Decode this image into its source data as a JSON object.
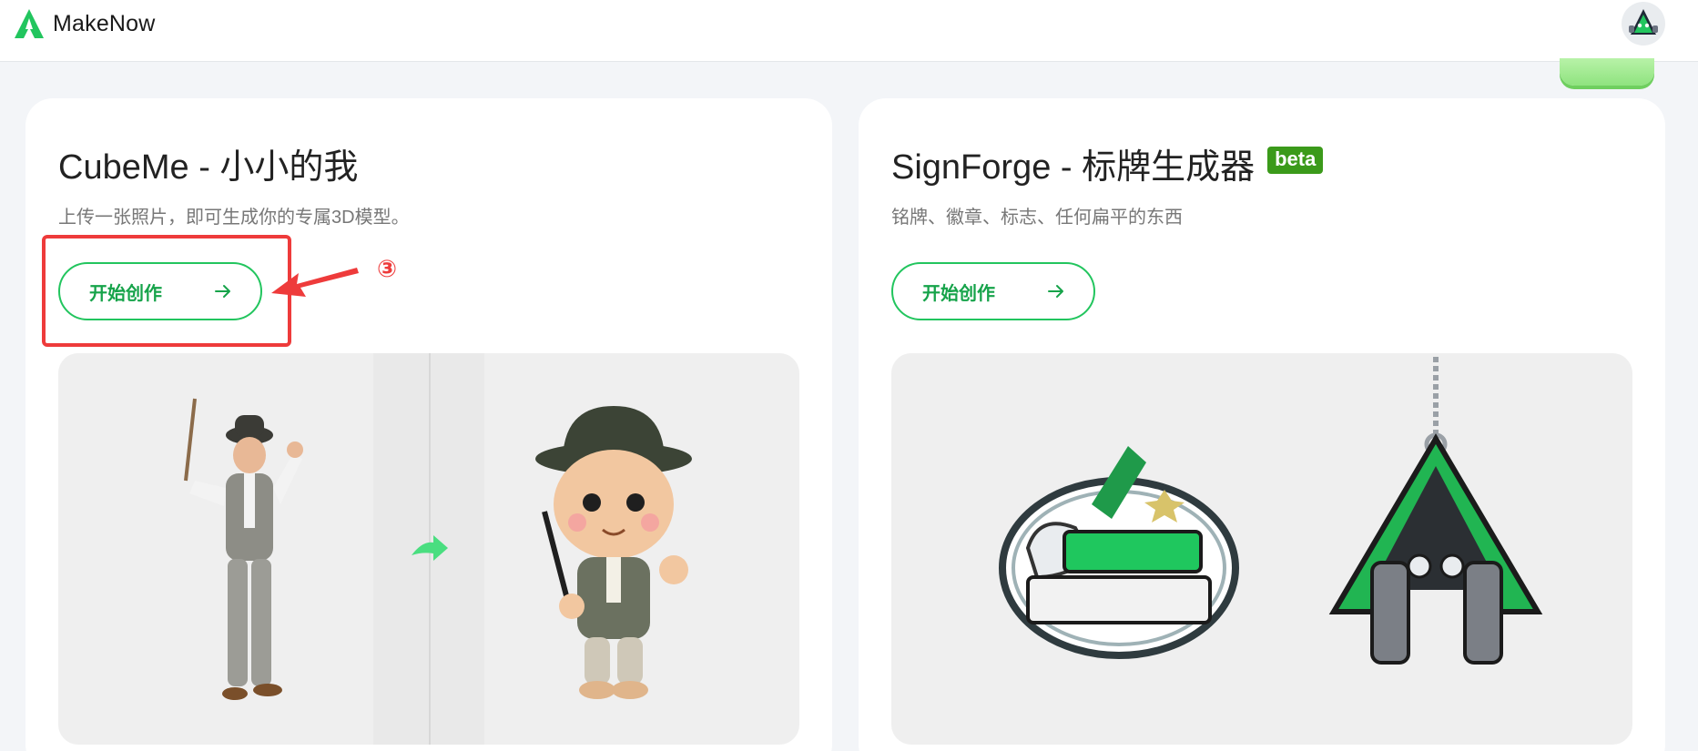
{
  "app": {
    "name": "MakeNow"
  },
  "colors": {
    "accent": "#22c55e",
    "annotation": "#ee3b3b",
    "beta_bg": "#3b9a1a"
  },
  "cards": [
    {
      "title": "CubeMe - 小小的我",
      "description": "上传一张照片，即可生成你的专属3D模型。",
      "button_label": "开始创作",
      "image_icon": "cartoon-figure-illustration"
    },
    {
      "title": "SignForge - 标牌生成器",
      "badge": "beta",
      "description": "铭牌、徽章、标志、任何扁平的东西",
      "button_label": "开始创作",
      "image_icon": "keychain-badge-illustration"
    }
  ],
  "annotation": {
    "step_number": "③"
  }
}
